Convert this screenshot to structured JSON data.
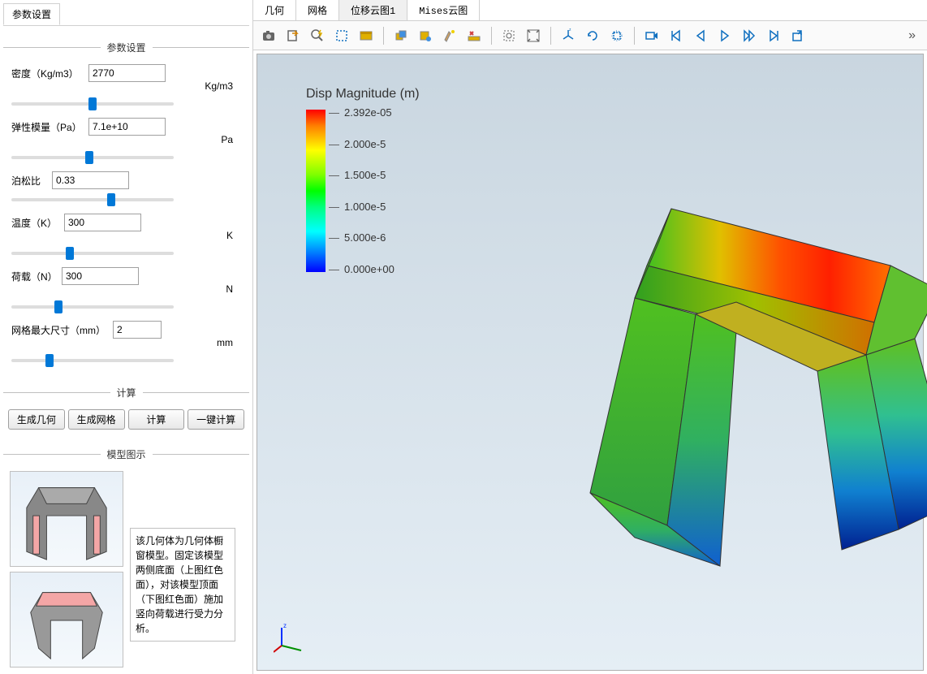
{
  "sidebar": {
    "tab_label": "参数设置",
    "sections": {
      "params_title": "参数设置",
      "calc_title": "计算",
      "model_title": "模型图示"
    },
    "params": {
      "density": {
        "label": "密度（Kg/m3）",
        "value": "2770",
        "unit": "Kg/m3"
      },
      "modulus": {
        "label": "弹性模量（Pa）",
        "value": "7.1e+10",
        "unit": "Pa"
      },
      "poisson": {
        "label": "泊松比",
        "value": "0.33",
        "unit": ""
      },
      "temperature": {
        "label": "温度（K）",
        "value": "300",
        "unit": "K"
      },
      "load": {
        "label": "荷载（N）",
        "value": "300",
        "unit": "N"
      },
      "mesh": {
        "label": "网格最大尺寸（mm）",
        "value": "2",
        "unit": "mm"
      }
    },
    "buttons": {
      "gen_geom": "生成几何",
      "gen_mesh": "生成网格",
      "calc": "计算",
      "one_click": "一键计算"
    },
    "description": "该几何体为几何体橱窗模型。固定该模型两侧底面（上图红色面），对该模型顶面（下图红色面）施加竖向荷载进行受力分析。"
  },
  "main_tabs": [
    "几何",
    "网格",
    "位移云图1",
    "Mises云图"
  ],
  "active_main_tab": 2,
  "toolbar_icons": [
    "camera-icon",
    "export-icon",
    "zoom-lightning-icon",
    "select-rect-icon",
    "select-window-icon",
    "sep",
    "box-multi-icon",
    "box-eye-icon",
    "sweep-icon",
    "ruler-x-icon",
    "sep",
    "zoom-fit-icon",
    "zoom-extents-icon",
    "sep",
    "axes-xyz-icon",
    "rotate-cw-icon",
    "rotate-reset-icon",
    "sep",
    "record-icon",
    "skip-start-icon",
    "play-back-icon",
    "play-icon",
    "play-fwd-icon",
    "skip-end-icon",
    "export-anim-icon"
  ],
  "legend": {
    "title": "Disp Magnitude (m)",
    "ticks": [
      "2.392e-05",
      "2.000e-5",
      "1.500e-5",
      "1.000e-5",
      "5.000e-6",
      "0.000e+00"
    ]
  }
}
